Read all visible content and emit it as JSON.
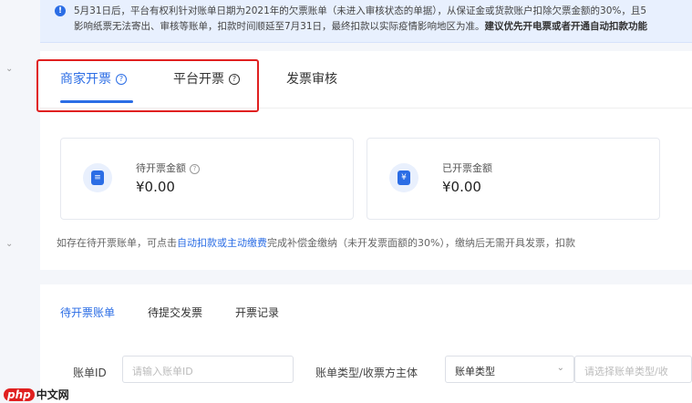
{
  "notice": {
    "line1": "5月31日后，平台有权利针对账单日期为2021年的欠票账单（未进入审核状态的单据），从保证金或货款账户扣除欠票金额的30%，且5",
    "line2_normal": "影响纸票无法寄出、审核等账单，扣款时间顺延至7月31日，最终扣款以实际疫情影响地区为准。",
    "line2_bold": "建议优先开电票或者开通自动扣款功能"
  },
  "tabs": [
    {
      "label": "商家开票",
      "active": true,
      "has_help": true
    },
    {
      "label": "平台开票",
      "active": false,
      "has_help": true
    },
    {
      "label": "发票审核",
      "active": false,
      "has_help": false
    }
  ],
  "stats": [
    {
      "label": "待开票金额",
      "value": "¥0.00",
      "icon": "document-icon",
      "glyph": "≡"
    },
    {
      "label": "已开票金额",
      "value": "¥0.00",
      "icon": "yen-ticket-icon",
      "glyph": "¥"
    }
  ],
  "hint": {
    "before": "如存在待开票账单，可点击",
    "link": "自动扣款或主动缴费",
    "after": "完成补偿金缴纳（未开发票面额的30%），缴纳后无需开具发票，扣款"
  },
  "sub_tabs": [
    {
      "label": "待开票账单",
      "active": true
    },
    {
      "label": "待提交发票",
      "active": false
    },
    {
      "label": "开票记录",
      "active": false
    }
  ],
  "filters": {
    "bill_id_label": "账单ID",
    "bill_id_placeholder": "请输入账单ID",
    "type_label": "账单类型/收票方主体",
    "type_select_value": "账单类型",
    "type_input_placeholder": "请选择账单类型/收"
  },
  "watermark": {
    "php": "php",
    "cn": "中文网"
  },
  "colors": {
    "accent": "#2b6de5",
    "highlight_box": "#e02020",
    "banner_bg": "#e8f0fe"
  }
}
